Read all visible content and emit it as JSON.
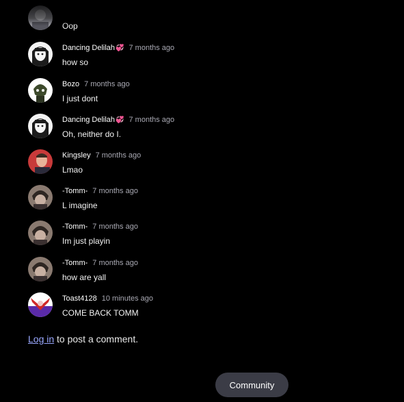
{
  "comments": [
    {
      "username": "",
      "time": "",
      "text": "Oop",
      "avatar": "partial-avatar",
      "emoji": ""
    },
    {
      "username": "Dancing Delilah",
      "emoji": "💞",
      "time": "7 months ago",
      "text": "how so",
      "avatar": "pale-girl-avatar"
    },
    {
      "username": "Bozo",
      "emoji": "",
      "time": "7 months ago",
      "text": "I just dont",
      "avatar": "green-goblin-avatar"
    },
    {
      "username": "Dancing Delilah",
      "emoji": "💞",
      "time": "7 months ago",
      "text": "Oh, neither do I.",
      "avatar": "pale-girl-avatar"
    },
    {
      "username": "Kingsley",
      "emoji": "",
      "time": "7 months ago",
      "text": "Lmao",
      "avatar": "red-man-avatar"
    },
    {
      "username": "-Tomm-",
      "emoji": "",
      "time": "7 months ago",
      "text": "L imagine",
      "avatar": "tomm-avatar"
    },
    {
      "username": "-Tomm-",
      "emoji": "",
      "time": "7 months ago",
      "text": "Im just playin",
      "avatar": "tomm-avatar"
    },
    {
      "username": "-Tomm-",
      "emoji": "",
      "time": "7 months ago",
      "text": "how are yall",
      "avatar": "tomm-avatar"
    },
    {
      "username": "Toast4128",
      "emoji": "",
      "time": "10 minutes ago",
      "text": "COME BACK TOMM",
      "avatar": "red-purple-avatar"
    }
  ],
  "login": {
    "link_label": "Log in",
    "suffix": " to post a comment."
  },
  "community_button": "Community",
  "colors": {
    "background": "#000000",
    "timestamp": "#a9a9b3",
    "link": "#9aa8ff",
    "button": "#3b3c46"
  }
}
